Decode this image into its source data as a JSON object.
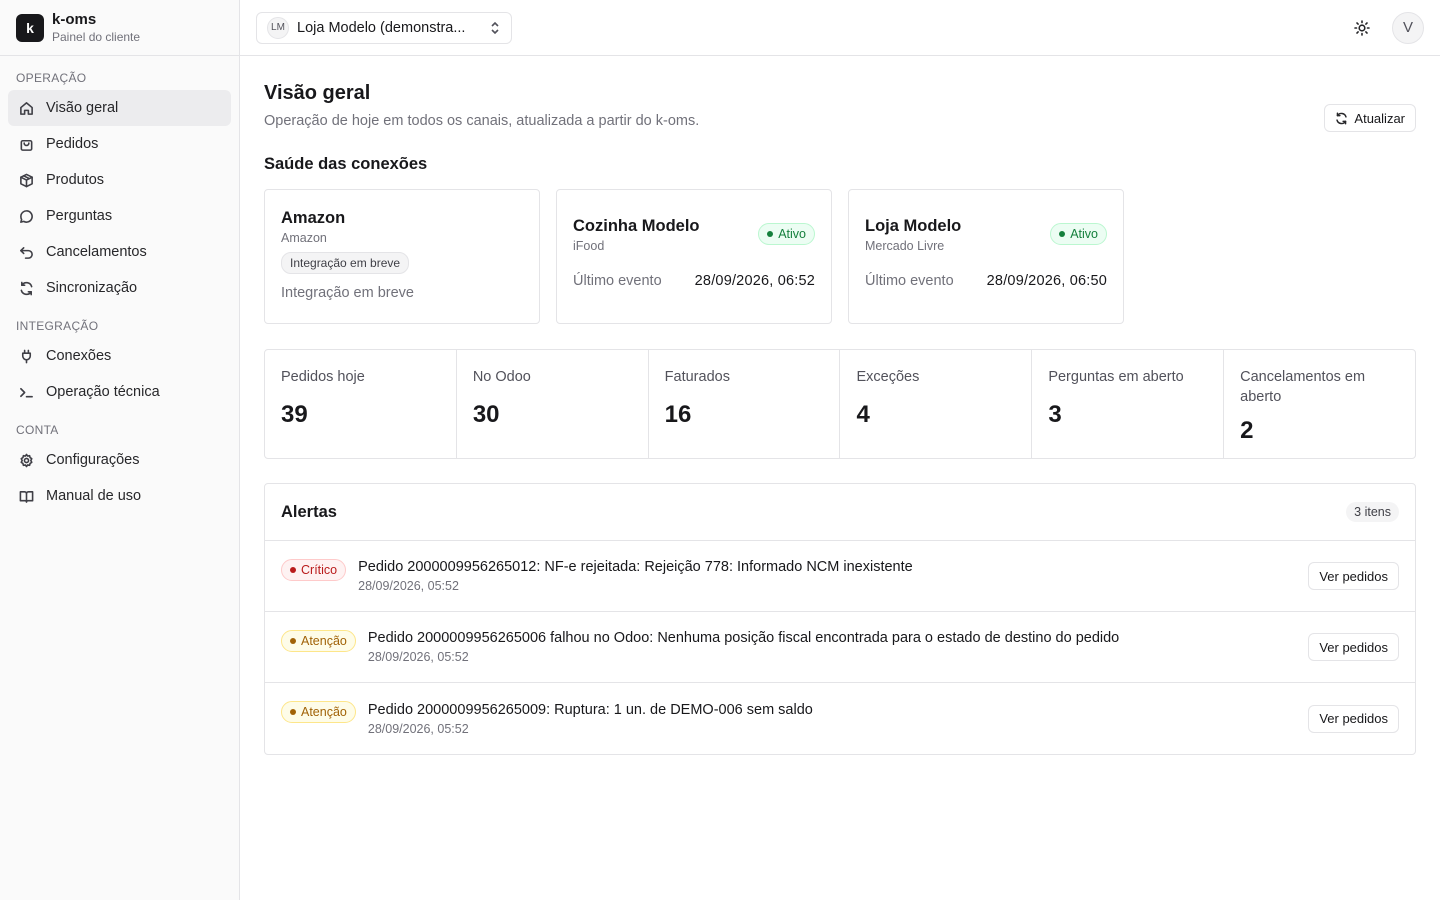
{
  "brand": {
    "logo": "k",
    "name": "k-oms",
    "subtitle": "Painel do cliente"
  },
  "sidebar": {
    "sections": [
      {
        "title": "OPERAÇÃO",
        "items": [
          {
            "label": "Visão geral",
            "icon": "home-icon",
            "active": true
          },
          {
            "label": "Pedidos",
            "icon": "bag-icon"
          },
          {
            "label": "Produtos",
            "icon": "box-icon"
          },
          {
            "label": "Perguntas",
            "icon": "chat-icon"
          },
          {
            "label": "Cancelamentos",
            "icon": "undo-icon"
          },
          {
            "label": "Sincronização",
            "icon": "refresh-icon"
          }
        ]
      },
      {
        "title": "INTEGRAÇÃO",
        "items": [
          {
            "label": "Conexões",
            "icon": "plug-icon"
          },
          {
            "label": "Operação técnica",
            "icon": "terminal-icon"
          }
        ]
      },
      {
        "title": "CONTA",
        "items": [
          {
            "label": "Configurações",
            "icon": "gear-icon"
          },
          {
            "label": "Manual de uso",
            "icon": "book-icon"
          }
        ]
      }
    ]
  },
  "topbar": {
    "store_initials": "LM",
    "store_name": "Loja Modelo (demonstra...",
    "user_initial": "V"
  },
  "page": {
    "title": "Visão geral",
    "subtitle": "Operação de hoje em todos os canais, atualizada a partir do k-oms.",
    "refresh_label": "Atualizar"
  },
  "connections": {
    "title": "Saúde das conexões",
    "cards": [
      {
        "name": "Amazon",
        "channel": "Amazon",
        "badge": "Integração em breve",
        "note": "Integração em breve"
      },
      {
        "name": "Cozinha Modelo",
        "channel": "iFood",
        "status": "Ativo",
        "event_label": "Último evento",
        "event_value": "28/09/2026, 06:52"
      },
      {
        "name": "Loja Modelo",
        "channel": "Mercado Livre",
        "status": "Ativo",
        "event_label": "Último evento",
        "event_value": "28/09/2026, 06:50"
      }
    ]
  },
  "metrics": [
    {
      "label": "Pedidos hoje",
      "value": "39"
    },
    {
      "label": "No Odoo",
      "value": "30"
    },
    {
      "label": "Faturados",
      "value": "16"
    },
    {
      "label": "Exceções",
      "value": "4"
    },
    {
      "label": "Perguntas em aberto",
      "value": "3"
    },
    {
      "label": "Cancelamentos em aberto",
      "value": "2"
    }
  ],
  "alerts": {
    "title": "Alertas",
    "count": "3 itens",
    "action_label": "Ver pedidos",
    "items": [
      {
        "severity": "Crítico",
        "level": "critical",
        "message": "Pedido 2000009956265012: NF-e rejeitada: Rejeição 778: Informado NCM inexistente",
        "time": "28/09/2026, 05:52"
      },
      {
        "severity": "Atenção",
        "level": "warning",
        "message": "Pedido 2000009956265006 falhou no Odoo: Nenhuma posição fiscal encontrada para o estado de destino do pedido",
        "time": "28/09/2026, 05:52"
      },
      {
        "severity": "Atenção",
        "level": "warning",
        "message": "Pedido 2000009956265009: Ruptura: 1 un. de DEMO-006 sem saldo",
        "time": "28/09/2026, 05:52"
      }
    ]
  },
  "colors": {
    "critical": "#b91c1c",
    "warning": "#a16207",
    "success": "#15803d"
  }
}
